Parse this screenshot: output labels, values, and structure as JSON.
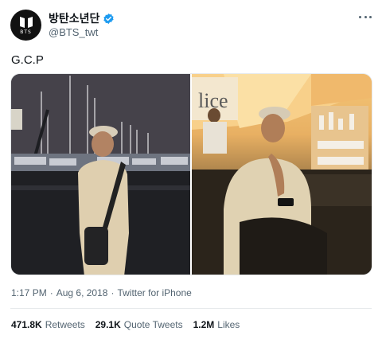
{
  "account": {
    "display_name": "방탄소년단",
    "handle": "@BTS_twt",
    "avatar_text": "BTS",
    "verified_icon": "verified-badge-icon"
  },
  "tweet": {
    "text": "G.C.P",
    "time": "1:17 PM",
    "separator": "·",
    "date": "Aug 6, 2018",
    "source": "Twitter for iPhone"
  },
  "media": {
    "count": 2
  },
  "stats": {
    "retweets_count": "471.8K",
    "retweets_label": "Retweets",
    "quotes_count": "29.1K",
    "quotes_label": "Quote Tweets",
    "likes_count": "1.2M",
    "likes_label": "Likes"
  },
  "colors": {
    "text_primary": "#0f1419",
    "text_secondary": "#536471",
    "verified": "#1d9bf0",
    "divider": "#e6e9eb"
  }
}
